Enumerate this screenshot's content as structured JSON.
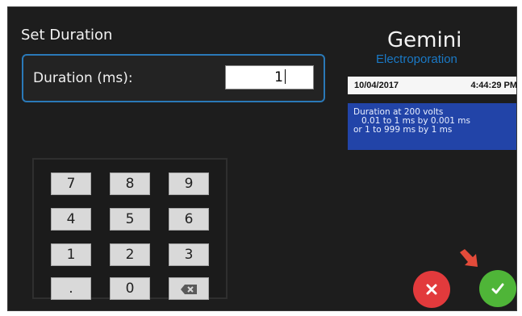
{
  "title": "Set Duration",
  "duration": {
    "label": "Duration (ms):",
    "value": "1"
  },
  "header": {
    "app_name": "Gemini",
    "app_subtitle": "Electroporation",
    "date": "10/04/2017",
    "time": "4:44:29 PM"
  },
  "info": {
    "line1": "Duration at 200 volts",
    "line2": "   0.01 to 1 ms by 0.001 ms",
    "line3": "or 1 to 999 ms by 1 ms"
  },
  "keypad": {
    "keys": [
      "7",
      "8",
      "9",
      "4",
      "5",
      "6",
      "1",
      "2",
      "3",
      ".",
      "0"
    ]
  },
  "buttons": {
    "cancel_icon": "close-icon",
    "ok_icon": "check-icon"
  },
  "colors": {
    "accent": "#2a79b8",
    "info_bg": "#2244a8",
    "cancel": "#e23a3c",
    "ok": "#4fb538",
    "arrow": "#e34b3a"
  }
}
